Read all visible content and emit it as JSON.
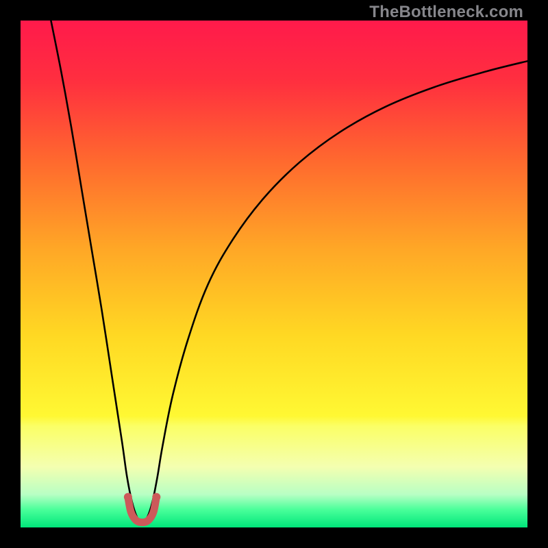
{
  "watermark": "TheBottleneck.com",
  "chart_data": {
    "type": "line",
    "title": "",
    "xlabel": "",
    "ylabel": "",
    "xlim": [
      0,
      100
    ],
    "ylim": [
      0,
      100
    ],
    "grid": false,
    "legend": false,
    "gradient_stops": [
      {
        "offset": 0.0,
        "color": "#ff1a4b"
      },
      {
        "offset": 0.12,
        "color": "#ff2f3f"
      },
      {
        "offset": 0.28,
        "color": "#ff6a2e"
      },
      {
        "offset": 0.45,
        "color": "#ffa726"
      },
      {
        "offset": 0.62,
        "color": "#ffd823"
      },
      {
        "offset": 0.78,
        "color": "#fff833"
      },
      {
        "offset": 0.8,
        "color": "#fbff66"
      },
      {
        "offset": 0.88,
        "color": "#f4ffb0"
      },
      {
        "offset": 0.935,
        "color": "#b8ffc4"
      },
      {
        "offset": 0.965,
        "color": "#49ff9a"
      },
      {
        "offset": 1.0,
        "color": "#00e67a"
      }
    ],
    "series": [
      {
        "name": "bottleneck-curve",
        "stroke": "#000000",
        "x": [
          6,
          8,
          10,
          12,
          14,
          16,
          18,
          20,
          21,
          22,
          23,
          24,
          25,
          26,
          27,
          28,
          30,
          33,
          37,
          42,
          48,
          55,
          63,
          72,
          82,
          92,
          100
        ],
        "values": [
          100,
          90,
          79,
          67,
          55,
          43,
          30,
          17,
          10,
          5,
          2,
          1,
          2,
          5,
          10,
          16,
          26,
          37,
          48,
          57,
          65,
          72,
          78,
          83,
          87,
          90,
          92
        ]
      }
    ],
    "highlight": {
      "name": "notch-marker",
      "stroke": "#cc5a5a",
      "x": [
        21.2,
        21.8,
        22.8,
        24.0,
        25.2,
        26.2,
        26.8
      ],
      "values": [
        6.0,
        3.0,
        1.4,
        1.0,
        1.4,
        3.0,
        6.0
      ],
      "dot_radius": 6
    }
  }
}
